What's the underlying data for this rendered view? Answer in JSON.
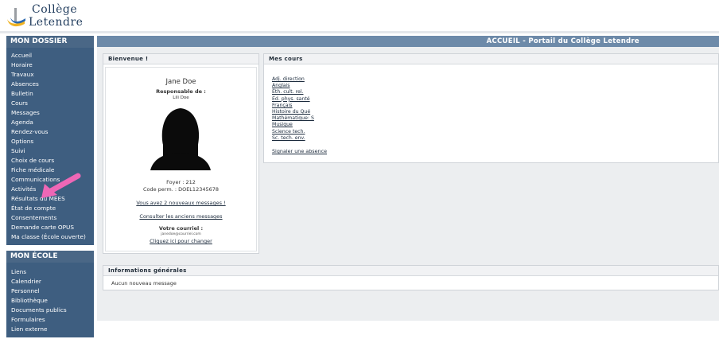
{
  "logo": {
    "line1": "Collège",
    "line2": "Letendre"
  },
  "sidebar": {
    "dossier_title": "MON DOSSIER",
    "dossier_items": [
      "Accueil",
      "Horaire",
      "Travaux",
      "Absences",
      "Bulletin",
      "Cours",
      "Messages",
      "Agenda",
      "Rendez-vous",
      "Options",
      "Suivi",
      "Choix de cours",
      "Fiche médicale",
      "Communications",
      "Activités",
      "Résultats du MEES",
      "État de compte",
      "Consentements",
      "Demande carte OPUS",
      "Ma classe (École ouverte)"
    ],
    "ecole_title": "MON ÉCOLE",
    "ecole_items": [
      "Liens",
      "Calendrier",
      "Personnel",
      "Bibliothèque",
      "Documents publics",
      "Formulaires",
      "Lien externe"
    ]
  },
  "main": {
    "title": "ACCUEIL - Portail du Collège Letendre"
  },
  "welcome": {
    "title": "Bienvenue !",
    "name": "Jane Doe",
    "responsible_label": "Responsable de :",
    "child": "Lili Doe",
    "foyer": "Foyer : 212",
    "code": "Code perm. : DOEL12345678",
    "new_messages": "Vous avez 2 nouveaux messages !",
    "old_messages": "Consulter les anciens messages",
    "email_label": "Votre courriel :",
    "email": "janedoe@courriel.com",
    "change": "Cliquez ici pour changer"
  },
  "courses": {
    "title": "Mes cours",
    "items": [
      "Adj. direction",
      "Anglais",
      "Éth. cult. rel.",
      "Éd. phys. santé",
      "Français",
      "Histoire du Qué",
      "Mathématique: S",
      "Musique",
      "Science tech.",
      "Sc. tech. env."
    ],
    "absence": "Signaler une absence"
  },
  "infos": {
    "title": "Informations générales",
    "message": "Aucun nouveau message"
  },
  "colors": {
    "sidebar": "#3e5e80",
    "header_bar": "#6d8aa9",
    "arrow": "#ee67b6"
  }
}
